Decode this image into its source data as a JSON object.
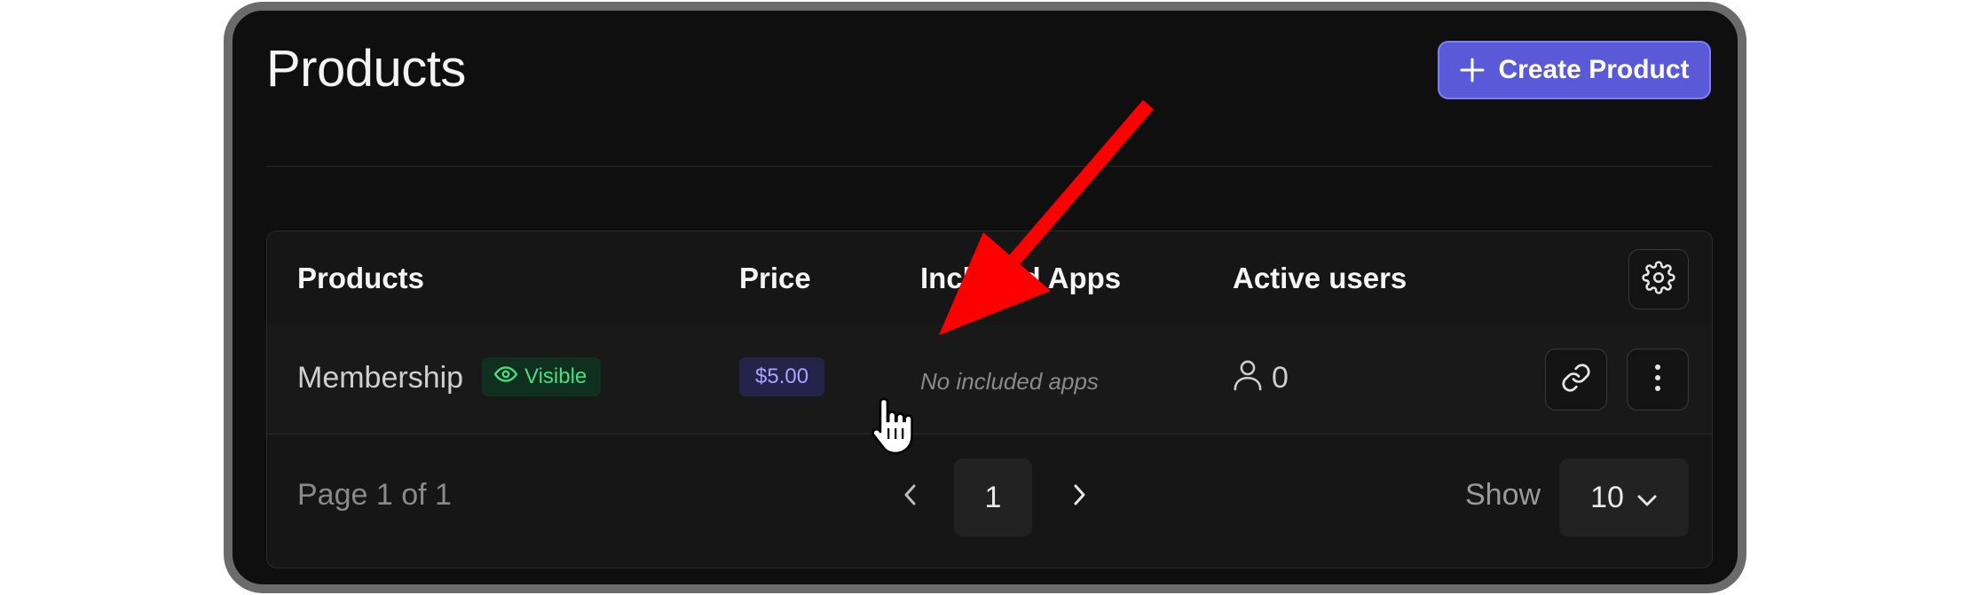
{
  "header": {
    "title": "Products",
    "create_button_label": "Create Product"
  },
  "table": {
    "columns": [
      "Products",
      "Price",
      "Included Apps",
      "Active users"
    ],
    "rows": [
      {
        "name": "Membership",
        "visibility": "Visible",
        "price": "$5.00",
        "included_apps": "No included apps",
        "active_users": "0"
      }
    ]
  },
  "pagination": {
    "page_info": "Page 1 of 1",
    "current_page": "1",
    "show_label": "Show",
    "page_size": "10"
  },
  "icons": {
    "create": "plus-icon",
    "settings": "gear-icon",
    "visible": "eye-icon",
    "users": "user-icon",
    "link": "link-icon",
    "more": "more-vertical-icon",
    "prev": "chevron-left-icon",
    "next": "chevron-right-icon",
    "dropdown": "chevron-down-icon"
  },
  "colors": {
    "accent": "#5a5ad8",
    "visible_badge": "#4ade80",
    "price_badge": "#a5a5ff",
    "annotation_arrow": "#ff0000"
  }
}
